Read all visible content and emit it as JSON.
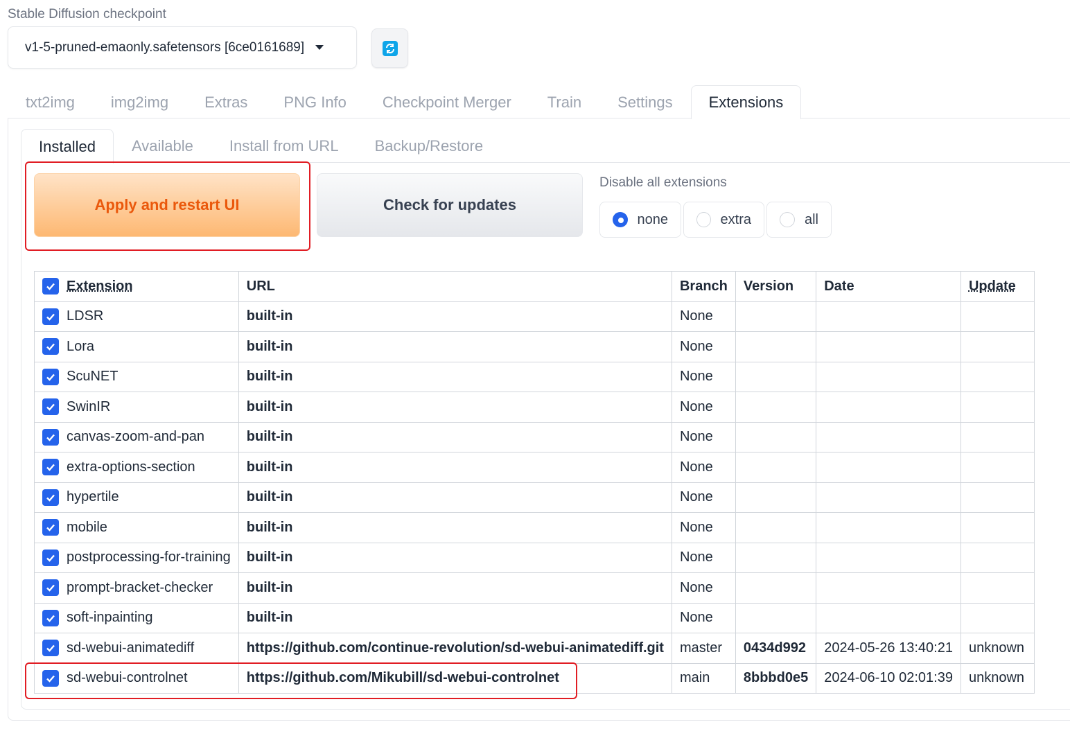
{
  "checkpoint": {
    "label": "Stable Diffusion checkpoint",
    "value": "v1-5-pruned-emaonly.safetensors [6ce0161689]",
    "refresh_icon": "refresh-icon"
  },
  "main_tabs": [
    "txt2img",
    "img2img",
    "Extras",
    "PNG Info",
    "Checkpoint Merger",
    "Train",
    "Settings",
    "Extensions"
  ],
  "main_tab_active": "Extensions",
  "sub_tabs": [
    "Installed",
    "Available",
    "Install from URL",
    "Backup/Restore"
  ],
  "sub_tab_active": "Installed",
  "buttons": {
    "apply": "Apply and restart UI",
    "check": "Check for updates"
  },
  "disable": {
    "label": "Disable all extensions",
    "options": [
      "none",
      "extra",
      "all"
    ],
    "selected": "none"
  },
  "table": {
    "headers": {
      "extension": "Extension",
      "url": "URL",
      "branch": "Branch",
      "version": "Version",
      "date": "Date",
      "update": "Update"
    },
    "rows": [
      {
        "name": "LDSR",
        "url": "built-in",
        "branch": "None",
        "version": "",
        "date": "",
        "update": ""
      },
      {
        "name": "Lora",
        "url": "built-in",
        "branch": "None",
        "version": "",
        "date": "",
        "update": ""
      },
      {
        "name": "ScuNET",
        "url": "built-in",
        "branch": "None",
        "version": "",
        "date": "",
        "update": ""
      },
      {
        "name": "SwinIR",
        "url": "built-in",
        "branch": "None",
        "version": "",
        "date": "",
        "update": ""
      },
      {
        "name": "canvas-zoom-and-pan",
        "url": "built-in",
        "branch": "None",
        "version": "",
        "date": "",
        "update": ""
      },
      {
        "name": "extra-options-section",
        "url": "built-in",
        "branch": "None",
        "version": "",
        "date": "",
        "update": ""
      },
      {
        "name": "hypertile",
        "url": "built-in",
        "branch": "None",
        "version": "",
        "date": "",
        "update": ""
      },
      {
        "name": "mobile",
        "url": "built-in",
        "branch": "None",
        "version": "",
        "date": "",
        "update": ""
      },
      {
        "name": "postprocessing-for-training",
        "url": "built-in",
        "branch": "None",
        "version": "",
        "date": "",
        "update": ""
      },
      {
        "name": "prompt-bracket-checker",
        "url": "built-in",
        "branch": "None",
        "version": "",
        "date": "",
        "update": ""
      },
      {
        "name": "soft-inpainting",
        "url": "built-in",
        "branch": "None",
        "version": "",
        "date": "",
        "update": ""
      },
      {
        "name": "sd-webui-animatediff",
        "url": "https://github.com/continue-revolution/sd-webui-animatediff.git",
        "branch": "master",
        "version": "0434d992",
        "date": "2024-05-26 13:40:21",
        "update": "unknown"
      },
      {
        "name": "sd-webui-controlnet",
        "url": "https://github.com/Mikubill/sd-webui-controlnet",
        "branch": "main",
        "version": "8bbbd0e5",
        "date": "2024-06-10 02:01:39",
        "update": "unknown"
      }
    ]
  },
  "colors": {
    "accent": "#2563eb",
    "apply_text": "#ea580c",
    "highlight": "#e11d24"
  }
}
